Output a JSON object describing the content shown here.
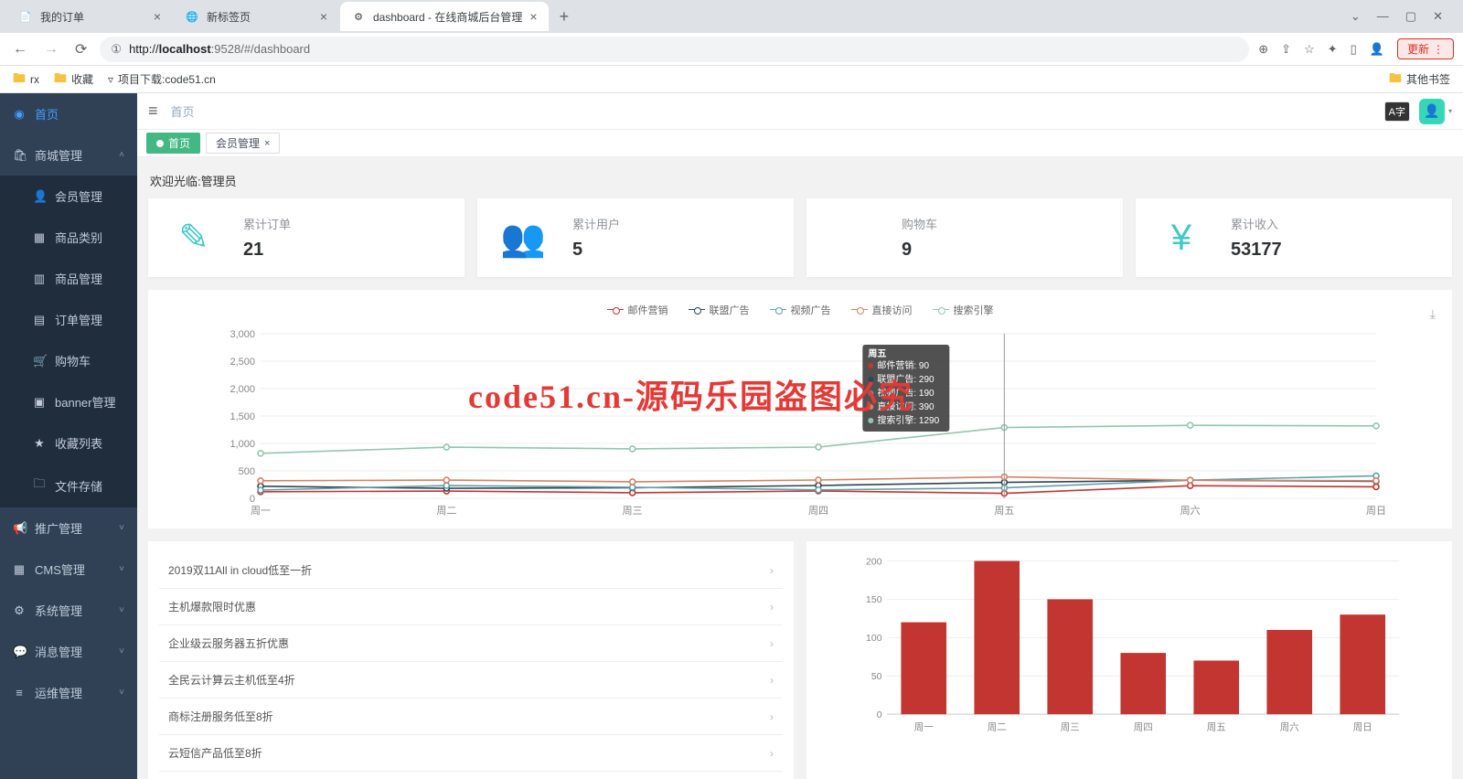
{
  "browser": {
    "tabs": [
      {
        "title": "我的订单",
        "favicon": "📄"
      },
      {
        "title": "新标签页",
        "favicon": "🌐"
      },
      {
        "title": "dashboard - 在线商城后台管理",
        "favicon": "⚙"
      }
    ],
    "active_tab": 2,
    "url_protocol_info": "①",
    "url_host": "localhost",
    "url_port": ":9528",
    "url_path": "/#/dashboard",
    "update_label": "更新",
    "bookmarks": {
      "rx": "rx",
      "fav": "收藏",
      "dl": "项目下载:code51.cn",
      "other": "其他书签"
    }
  },
  "sidebar": {
    "home": "首页",
    "mall_mgmt": "商城管理",
    "mall_children": [
      {
        "icon": "👤",
        "label": "会员管理"
      },
      {
        "icon": "▦",
        "label": "商品类别"
      },
      {
        "icon": "▥",
        "label": "商品管理"
      },
      {
        "icon": "▤",
        "label": "订单管理"
      },
      {
        "icon": "🛒",
        "label": "购物车"
      },
      {
        "icon": "▣",
        "label": "banner管理"
      },
      {
        "icon": "★",
        "label": "收藏列表"
      },
      {
        "icon": "🗀",
        "label": "文件存储"
      }
    ],
    "groups": [
      {
        "icon": "📢",
        "label": "推广管理"
      },
      {
        "icon": "▦",
        "label": "CMS管理"
      },
      {
        "icon": "⚙",
        "label": "系统管理"
      },
      {
        "icon": "💬",
        "label": "消息管理"
      },
      {
        "icon": "≡",
        "label": "运维管理"
      }
    ]
  },
  "header": {
    "breadcrumb": "首页",
    "lang": "A字"
  },
  "tabs": {
    "home": "首页",
    "member": "会员管理"
  },
  "welcome": "欢迎光临:管理员",
  "stats": [
    {
      "icon": "✎",
      "label": "累计订单",
      "value": "21"
    },
    {
      "icon": "👥",
      "label": "累计用户",
      "value": "5"
    },
    {
      "icon": "",
      "label": "购物车",
      "value": "9"
    },
    {
      "icon": "¥",
      "label": "累计收入",
      "value": "53177"
    }
  ],
  "chart_data": {
    "line_chart": {
      "type": "line",
      "categories": [
        "周一",
        "周二",
        "周三",
        "周四",
        "周五",
        "周六",
        "周日"
      ],
      "series": [
        {
          "name": "邮件营销",
          "color": "#c23531",
          "values": [
            120,
            132,
            101,
            134,
            90,
            230,
            210
          ]
        },
        {
          "name": "联盟广告",
          "color": "#2f4554",
          "values": [
            220,
            182,
            191,
            234,
            290,
            330,
            310
          ]
        },
        {
          "name": "视频广告",
          "color": "#61a0a8",
          "values": [
            150,
            232,
            201,
            154,
            190,
            330,
            410
          ]
        },
        {
          "name": "直接访问",
          "color": "#d48265",
          "values": [
            320,
            332,
            301,
            334,
            390,
            330,
            320
          ]
        },
        {
          "name": "搜索引擎",
          "color": "#91c7ae",
          "values": [
            820,
            932,
            901,
            934,
            1290,
            1330,
            1320
          ]
        }
      ],
      "yticks": [
        0,
        500,
        1000,
        1500,
        2000,
        2500,
        3000
      ],
      "ylim": [
        0,
        3000
      ],
      "tooltip": {
        "title": "周五",
        "rows": [
          {
            "name": "邮件营销",
            "value": 90,
            "color": "#c23531"
          },
          {
            "name": "联盟广告",
            "value": 290,
            "color": "#2f4554"
          },
          {
            "name": "视频广告",
            "value": 190,
            "color": "#61a0a8"
          },
          {
            "name": "直接访问",
            "value": 390,
            "color": "#d48265"
          },
          {
            "name": "搜索引擎",
            "value": 1290,
            "color": "#91c7ae"
          }
        ]
      }
    },
    "bar_chart": {
      "type": "bar",
      "categories": [
        "周一",
        "周二",
        "周三",
        "周四",
        "周五",
        "周六",
        "周日"
      ],
      "values": [
        120,
        200,
        150,
        80,
        70,
        110,
        130
      ],
      "yticks": [
        0,
        50,
        100,
        150,
        200
      ],
      "ylim": [
        0,
        200
      ],
      "color": "#c23531"
    }
  },
  "promo_list": [
    "2019双11All in cloud低至一折",
    "主机爆款限时优惠",
    "企业级云服务器五折优惠",
    "全民云计算云主机低至4折",
    "商标注册服务低至8折",
    "云短信产品低至8折"
  ],
  "watermark": "code51.cn-源码乐园盗图必究"
}
